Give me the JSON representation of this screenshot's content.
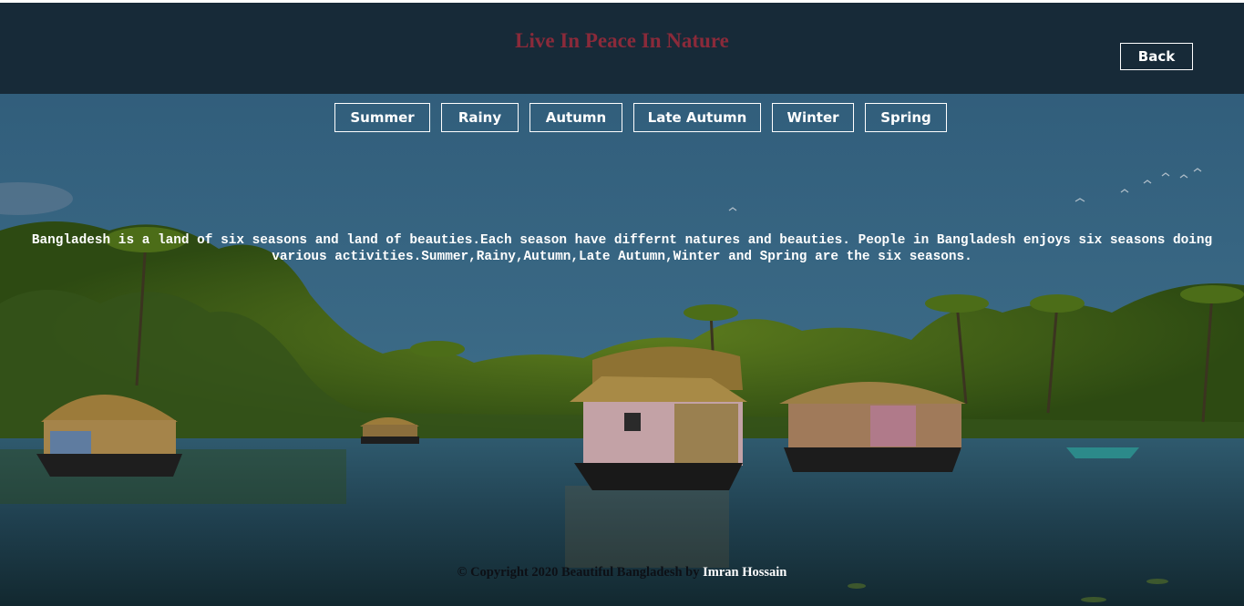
{
  "header": {
    "title": "Live In Peace In Nature",
    "back_label": "Back"
  },
  "seasons": [
    {
      "label": "Summer"
    },
    {
      "label": "Rainy"
    },
    {
      "label": "Autumn"
    },
    {
      "label": "Late Autumn"
    },
    {
      "label": "Winter"
    },
    {
      "label": "Spring"
    }
  ],
  "intro": {
    "text": "Bangladesh is a land of six seasons and land of beauties.Each season have differnt natures and beauties. People in Bangladesh enjoys six seasons doing various activities.Summer,Rainy,Autumn,Late Autumn,Winter and Spring are the six seasons."
  },
  "footer": {
    "text": "© Copyright 2020 Beautiful Bangladesh by ",
    "author": "Imran Hossain"
  },
  "colors": {
    "header_bg": "#172a38",
    "title": "#8a2a3a",
    "button_border": "#ffffff"
  }
}
